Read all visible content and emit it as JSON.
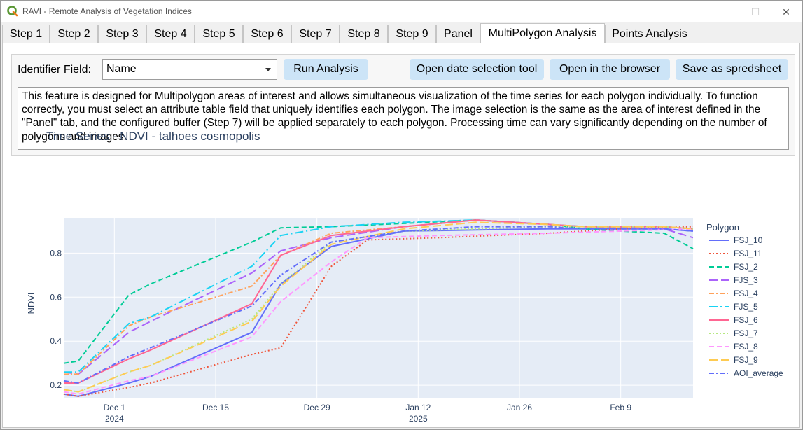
{
  "window": {
    "title": "RAVI - Remote Analysis of Vegetation Indices",
    "minimize": "—",
    "maximize": "☐",
    "close": "✕"
  },
  "tabs": [
    {
      "label": "Step 1",
      "active": false
    },
    {
      "label": "Step 2",
      "active": false
    },
    {
      "label": "Step 3",
      "active": false
    },
    {
      "label": "Step 4",
      "active": false
    },
    {
      "label": "Step 5",
      "active": false
    },
    {
      "label": "Step 6",
      "active": false
    },
    {
      "label": "Step 7",
      "active": false
    },
    {
      "label": "Step 8",
      "active": false
    },
    {
      "label": "Step 9",
      "active": false
    },
    {
      "label": "Panel",
      "active": false
    },
    {
      "label": "MultiPolygon Analysis",
      "active": true
    },
    {
      "label": "Points Analysis",
      "active": false
    }
  ],
  "controls": {
    "identifier_label": "Identifier Field:",
    "identifier_value": "Name",
    "run_button": "Run Analysis",
    "date_tool_button": "Open date selection tool",
    "browser_button": "Open in the browser",
    "spreadsheet_button": "Save as spredsheet",
    "info_text": "This feature is designed for Multipolygon areas of interest and allows simultaneous visualization of the time series for each polygon individually. To function correctly, you must select an attribute table field that uniquely identifies each polygon. The image selection is the same as the area of interest defined in the \"Panel\" tab, and the configured buffer (Step 7) will be applied separately to each polygon. Processing time can vary significantly depending on the number of polygons and images."
  },
  "chart_data": {
    "type": "line",
    "title": "Time Series - NDVI - talhoes cosmopolis",
    "xlabel": "",
    "ylabel": "NDVI",
    "xlim": [
      "2024-11-24",
      "2025-02-19"
    ],
    "ylim": [
      0.14,
      0.96
    ],
    "yticks": [
      0.2,
      0.4,
      0.6,
      0.8
    ],
    "xticks": [
      {
        "date": "2024-12-01",
        "label": "Dec 1",
        "sublabel": "2024"
      },
      {
        "date": "2024-12-15",
        "label": "Dec 15",
        "sublabel": ""
      },
      {
        "date": "2024-12-29",
        "label": "Dec 29",
        "sublabel": ""
      },
      {
        "date": "2025-01-12",
        "label": "Jan 12",
        "sublabel": "2025"
      },
      {
        "date": "2025-01-26",
        "label": "Jan 26",
        "sublabel": ""
      },
      {
        "date": "2025-02-09",
        "label": "Feb 9",
        "sublabel": ""
      }
    ],
    "grid": true,
    "legend_title": "Polygon",
    "legend_position": "right",
    "series": [
      {
        "name": "FSJ_10",
        "color": "#636efa",
        "dash": "solid",
        "x": [
          "2024-11-24",
          "2024-11-26",
          "2024-12-03",
          "2024-12-06",
          "2024-12-20",
          "2024-12-24",
          "2024-12-31",
          "2025-01-10",
          "2025-01-20",
          "2025-01-30",
          "2025-02-04",
          "2025-02-15",
          "2025-02-19"
        ],
        "y": [
          0.16,
          0.15,
          0.21,
          0.24,
          0.44,
          0.66,
          0.83,
          0.9,
          0.905,
          0.91,
          0.91,
          0.91,
          0.9
        ]
      },
      {
        "name": "FSJ_11",
        "color": "#ef553b",
        "dash": "dot",
        "x": [
          "2024-11-24",
          "2024-11-26",
          "2024-12-03",
          "2024-12-06",
          "2024-12-20",
          "2024-12-24",
          "2024-12-31",
          "2025-01-05",
          "2025-01-15",
          "2025-01-30",
          "2025-02-09",
          "2025-02-19"
        ],
        "y": [
          0.16,
          0.15,
          0.19,
          0.21,
          0.34,
          0.37,
          0.74,
          0.86,
          0.87,
          0.89,
          0.91,
          0.92
        ]
      },
      {
        "name": "FSJ_2",
        "color": "#00cc96",
        "dash": "dash",
        "x": [
          "2024-11-24",
          "2024-11-26",
          "2024-12-03",
          "2024-12-06",
          "2024-12-20",
          "2024-12-24",
          "2024-12-31",
          "2025-01-10",
          "2025-01-20",
          "2025-01-30",
          "2025-02-04",
          "2025-02-09",
          "2025-02-15",
          "2025-02-19"
        ],
        "y": [
          0.3,
          0.31,
          0.61,
          0.66,
          0.85,
          0.915,
          0.92,
          0.935,
          0.95,
          0.93,
          0.91,
          0.9,
          0.89,
          0.82
        ]
      },
      {
        "name": "FJS_3",
        "color": "#ab63fa",
        "dash": "longdash",
        "x": [
          "2024-11-24",
          "2024-11-26",
          "2024-12-03",
          "2024-12-06",
          "2024-12-20",
          "2024-12-24",
          "2024-12-31",
          "2025-01-10",
          "2025-01-20",
          "2025-01-30",
          "2025-02-04",
          "2025-02-15",
          "2025-02-19"
        ],
        "y": [
          0.26,
          0.25,
          0.44,
          0.49,
          0.71,
          0.81,
          0.87,
          0.92,
          0.95,
          0.93,
          0.92,
          0.91,
          0.87
        ]
      },
      {
        "name": "FSJ_4",
        "color": "#ffa15a",
        "dash": "dashdot",
        "x": [
          "2024-11-24",
          "2024-11-26",
          "2024-12-03",
          "2024-12-06",
          "2024-12-20",
          "2024-12-24",
          "2024-12-31",
          "2025-01-10",
          "2025-01-20",
          "2025-01-30",
          "2025-02-04",
          "2025-02-15",
          "2025-02-19"
        ],
        "y": [
          0.25,
          0.25,
          0.47,
          0.51,
          0.65,
          0.79,
          0.89,
          0.92,
          0.95,
          0.93,
          0.92,
          0.92,
          0.91
        ]
      },
      {
        "name": "FJS_5",
        "color": "#19d3f3",
        "dash": "longdashdot",
        "x": [
          "2024-11-24",
          "2024-11-26",
          "2024-12-03",
          "2024-12-06",
          "2024-12-20",
          "2024-12-24",
          "2024-12-31",
          "2025-01-10",
          "2025-01-20",
          "2025-01-30",
          "2025-02-04",
          "2025-02-15",
          "2025-02-19"
        ],
        "y": [
          0.26,
          0.26,
          0.48,
          0.51,
          0.74,
          0.88,
          0.92,
          0.94,
          0.95,
          0.93,
          0.92,
          0.92,
          0.91
        ]
      },
      {
        "name": "FSJ_6",
        "color": "#ff6692",
        "dash": "solid",
        "x": [
          "2024-11-24",
          "2024-11-26",
          "2024-12-03",
          "2024-12-06",
          "2024-12-20",
          "2024-12-24",
          "2024-12-31",
          "2025-01-10",
          "2025-01-20",
          "2025-01-30",
          "2025-02-04",
          "2025-02-15",
          "2025-02-19"
        ],
        "y": [
          0.21,
          0.21,
          0.32,
          0.36,
          0.57,
          0.79,
          0.88,
          0.92,
          0.95,
          0.93,
          0.92,
          0.92,
          0.91
        ]
      },
      {
        "name": "FSJ_7",
        "color": "#b6e880",
        "dash": "dot",
        "x": [
          "2024-11-24",
          "2024-11-26",
          "2024-12-03",
          "2024-12-06",
          "2024-12-20",
          "2024-12-24",
          "2024-12-31",
          "2025-01-10",
          "2025-01-20",
          "2025-01-30",
          "2025-02-04",
          "2025-02-15",
          "2025-02-19"
        ],
        "y": [
          0.18,
          0.17,
          0.26,
          0.29,
          0.5,
          0.66,
          0.85,
          0.9,
          0.91,
          0.92,
          0.92,
          0.92,
          0.91
        ]
      },
      {
        "name": "FSJ_8",
        "color": "#ff97ff",
        "dash": "dash",
        "x": [
          "2024-11-24",
          "2024-11-26",
          "2024-12-03",
          "2024-12-06",
          "2024-12-20",
          "2024-12-24",
          "2024-12-31",
          "2025-01-05",
          "2025-01-15",
          "2025-01-30",
          "2025-02-09",
          "2025-02-19"
        ],
        "y": [
          0.17,
          0.16,
          0.22,
          0.24,
          0.42,
          0.58,
          0.76,
          0.87,
          0.88,
          0.89,
          0.9,
          0.91
        ]
      },
      {
        "name": "FSJ_9",
        "color": "#fecb52",
        "dash": "longdash",
        "x": [
          "2024-11-24",
          "2024-11-26",
          "2024-12-03",
          "2024-12-06",
          "2024-12-20",
          "2024-12-24",
          "2024-12-31",
          "2025-01-10",
          "2025-01-20",
          "2025-01-30",
          "2025-02-04",
          "2025-02-15",
          "2025-02-19"
        ],
        "y": [
          0.18,
          0.17,
          0.26,
          0.29,
          0.49,
          0.65,
          0.84,
          0.91,
          0.94,
          0.93,
          0.92,
          0.92,
          0.91
        ]
      },
      {
        "name": "AOI_average",
        "color": "#636efa",
        "dash": "dashdot",
        "x": [
          "2024-11-24",
          "2024-11-26",
          "2024-12-03",
          "2024-12-06",
          "2024-12-20",
          "2024-12-24",
          "2024-12-31",
          "2025-01-10",
          "2025-01-20",
          "2025-01-30",
          "2025-02-04",
          "2025-02-15",
          "2025-02-19"
        ],
        "y": [
          0.22,
          0.21,
          0.33,
          0.37,
          0.56,
          0.7,
          0.85,
          0.9,
          0.92,
          0.92,
          0.91,
          0.91,
          0.9
        ]
      }
    ]
  }
}
